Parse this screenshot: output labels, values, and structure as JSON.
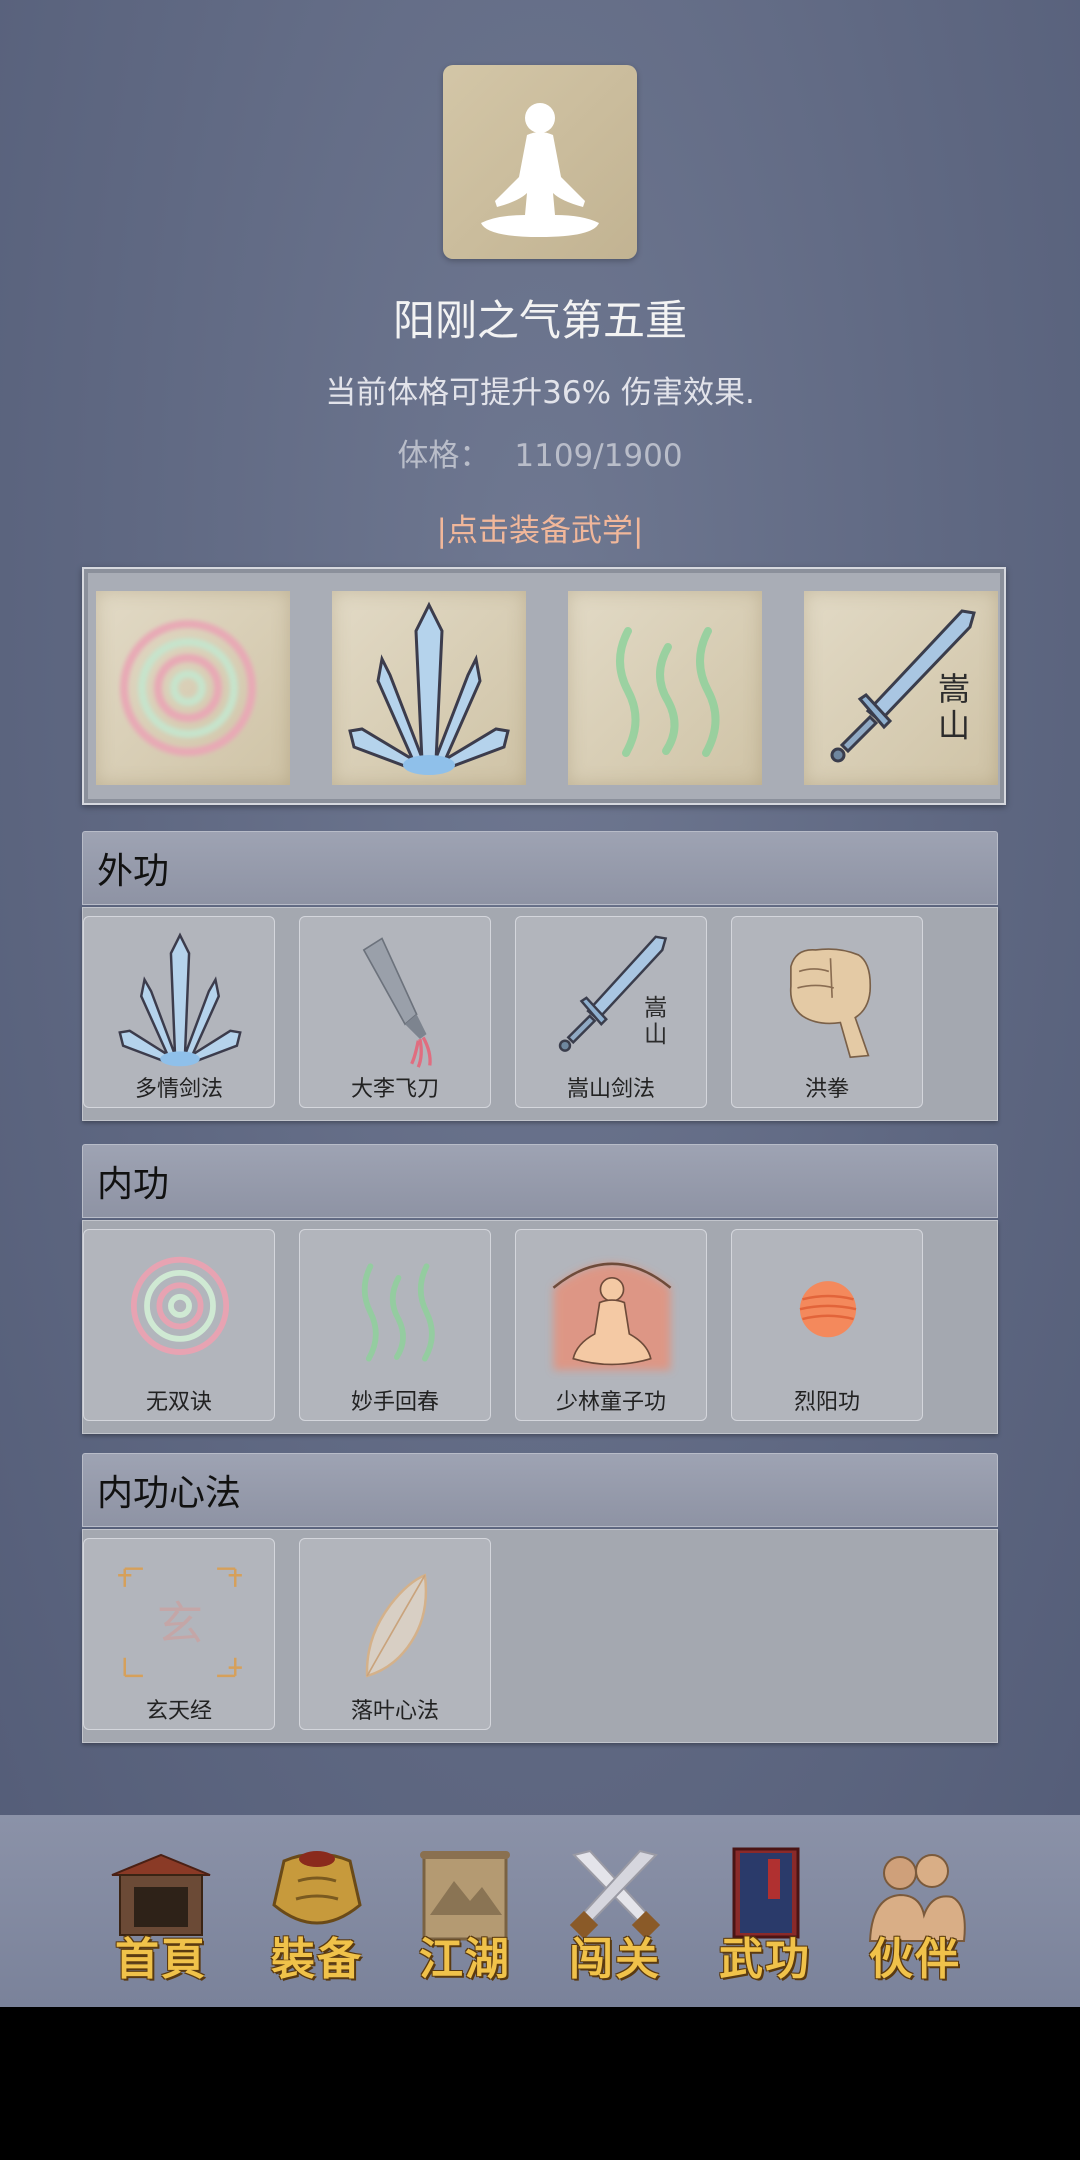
{
  "realm": {
    "title": "阳刚之气第五重",
    "description": "当前体格可提升36% 伤害效果.",
    "stat_label": "体格：",
    "stat_value": "1109/1900",
    "equip_link": "|点击装备武学|"
  },
  "equipped": [
    {
      "icon": "spiral-icon"
    },
    {
      "icon": "blade-fan-icon"
    },
    {
      "icon": "green-wave-icon"
    },
    {
      "icon": "songshan-sword-icon",
      "icon_text": "嵩山"
    }
  ],
  "sections": {
    "waigong": {
      "title": "外功",
      "skills": [
        {
          "name": "多情剑法",
          "icon": "blade-fan-icon"
        },
        {
          "name": "大李飞刀",
          "icon": "cleaver-icon"
        },
        {
          "name": "嵩山剑法",
          "icon": "songshan-sword-icon",
          "icon_text": "嵩山"
        },
        {
          "name": "洪拳",
          "icon": "fist-icon"
        }
      ]
    },
    "neigong": {
      "title": "内功",
      "skills": [
        {
          "name": "无双诀",
          "icon": "spiral-icon"
        },
        {
          "name": "妙手回春",
          "icon": "green-wave-icon"
        },
        {
          "name": "少林童子功",
          "icon": "meditating-monk-icon"
        },
        {
          "name": "烈阳功",
          "icon": "sun-orb-icon"
        }
      ]
    },
    "xinfa": {
      "title": "内功心法",
      "skills": [
        {
          "name": "玄天经",
          "icon": "xuan-seal-icon",
          "icon_text": "玄"
        },
        {
          "name": "落叶心法",
          "icon": "leaf-icon"
        }
      ]
    }
  },
  "nav": [
    {
      "label": "首頁",
      "icon": "house-icon"
    },
    {
      "label": "裝备",
      "icon": "armor-icon"
    },
    {
      "label": "江湖",
      "icon": "scroll-icon"
    },
    {
      "label": "闯关",
      "icon": "crossed-swords-icon"
    },
    {
      "label": "武功",
      "icon": "book-icon"
    },
    {
      "label": "伙伴",
      "icon": "companions-icon"
    }
  ],
  "colors": {
    "background": "#5f6882",
    "accent_link": "#f1b79a",
    "nav_label": "#f0c24a"
  }
}
